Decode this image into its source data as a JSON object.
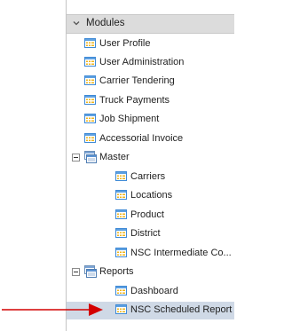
{
  "tree": {
    "header": {
      "label": "Modules"
    },
    "modules": [
      {
        "label": "User Profile"
      },
      {
        "label": "User Administration"
      },
      {
        "label": "Carrier Tendering"
      },
      {
        "label": "Truck Payments"
      },
      {
        "label": "Job Shipment"
      },
      {
        "label": "Accessorial Invoice"
      }
    ],
    "master": {
      "label": "Master",
      "children": [
        {
          "label": "Carriers"
        },
        {
          "label": "Locations"
        },
        {
          "label": "Product"
        },
        {
          "label": "District"
        },
        {
          "label": "NSC Intermediate Co..."
        }
      ]
    },
    "reports": {
      "label": "Reports",
      "children": [
        {
          "label": "Dashboard"
        },
        {
          "label": "NSC Scheduled Report"
        }
      ]
    }
  },
  "colors": {
    "selection": "#cfd9e6",
    "annotation_arrow": "#d40000",
    "icon_fill": "#f0b51c",
    "icon_border": "#3f8ad6"
  }
}
